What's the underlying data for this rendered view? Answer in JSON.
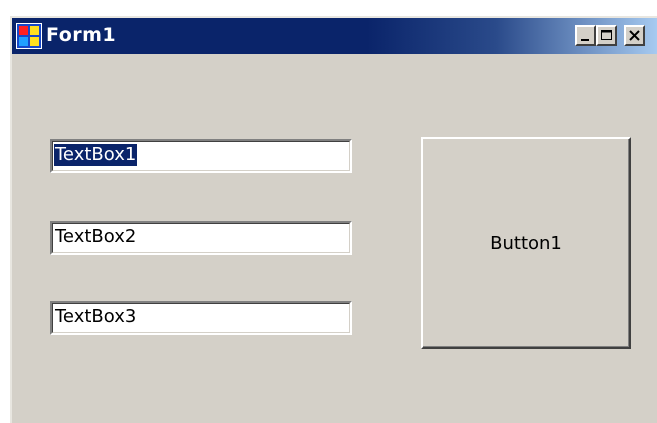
{
  "window": {
    "title": "Form1",
    "icon": "form-app-icon",
    "controls": {
      "minimize_icon": "minimize-icon",
      "maximize_icon": "maximize-icon",
      "close_icon": "close-icon"
    }
  },
  "form": {
    "textboxes": [
      {
        "value": "TextBox1",
        "selected": true
      },
      {
        "value": "TextBox2",
        "selected": false
      },
      {
        "value": "TextBox3",
        "selected": false
      }
    ],
    "button1_label": "Button1"
  },
  "colors": {
    "titlebar": "#0a246a",
    "face": "#d4d0c8",
    "selection": "#0a246a"
  }
}
